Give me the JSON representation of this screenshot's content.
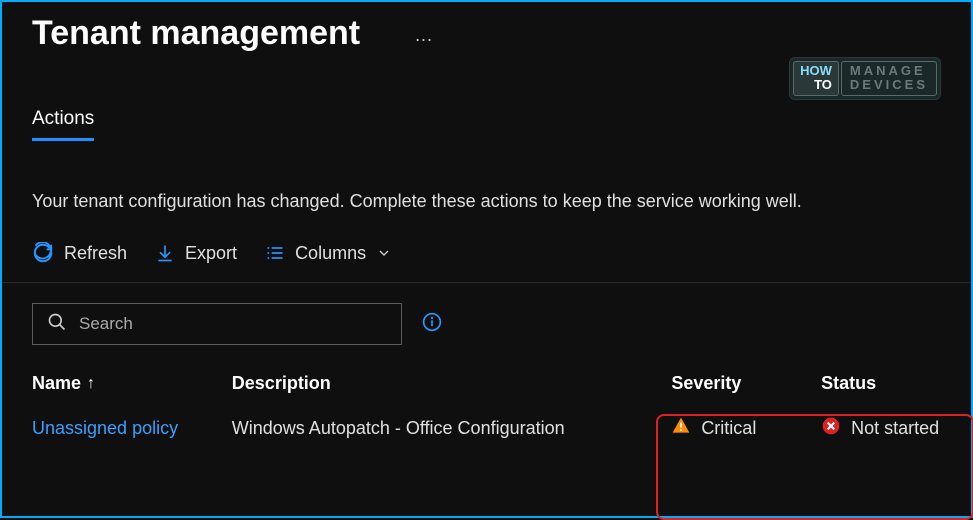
{
  "page": {
    "title": "Tenant management",
    "ellipsis": "···"
  },
  "watermark": {
    "how": "HOW",
    "to": "TO",
    "manage": "MANAGE",
    "devices": "DEVICES"
  },
  "tabs": {
    "active": "Actions"
  },
  "info": {
    "message": "Your tenant configuration has changed. Complete these actions to keep the service working well."
  },
  "toolbar": {
    "refresh": "Refresh",
    "export": "Export",
    "columns": "Columns"
  },
  "search": {
    "placeholder": "Search"
  },
  "table": {
    "headers": {
      "name": "Name",
      "description": "Description",
      "severity": "Severity",
      "status": "Status"
    },
    "rows": [
      {
        "name": "Unassigned policy",
        "description": "Windows Autopatch - Office Configuration",
        "severity": "Critical",
        "status": "Not started"
      }
    ]
  }
}
